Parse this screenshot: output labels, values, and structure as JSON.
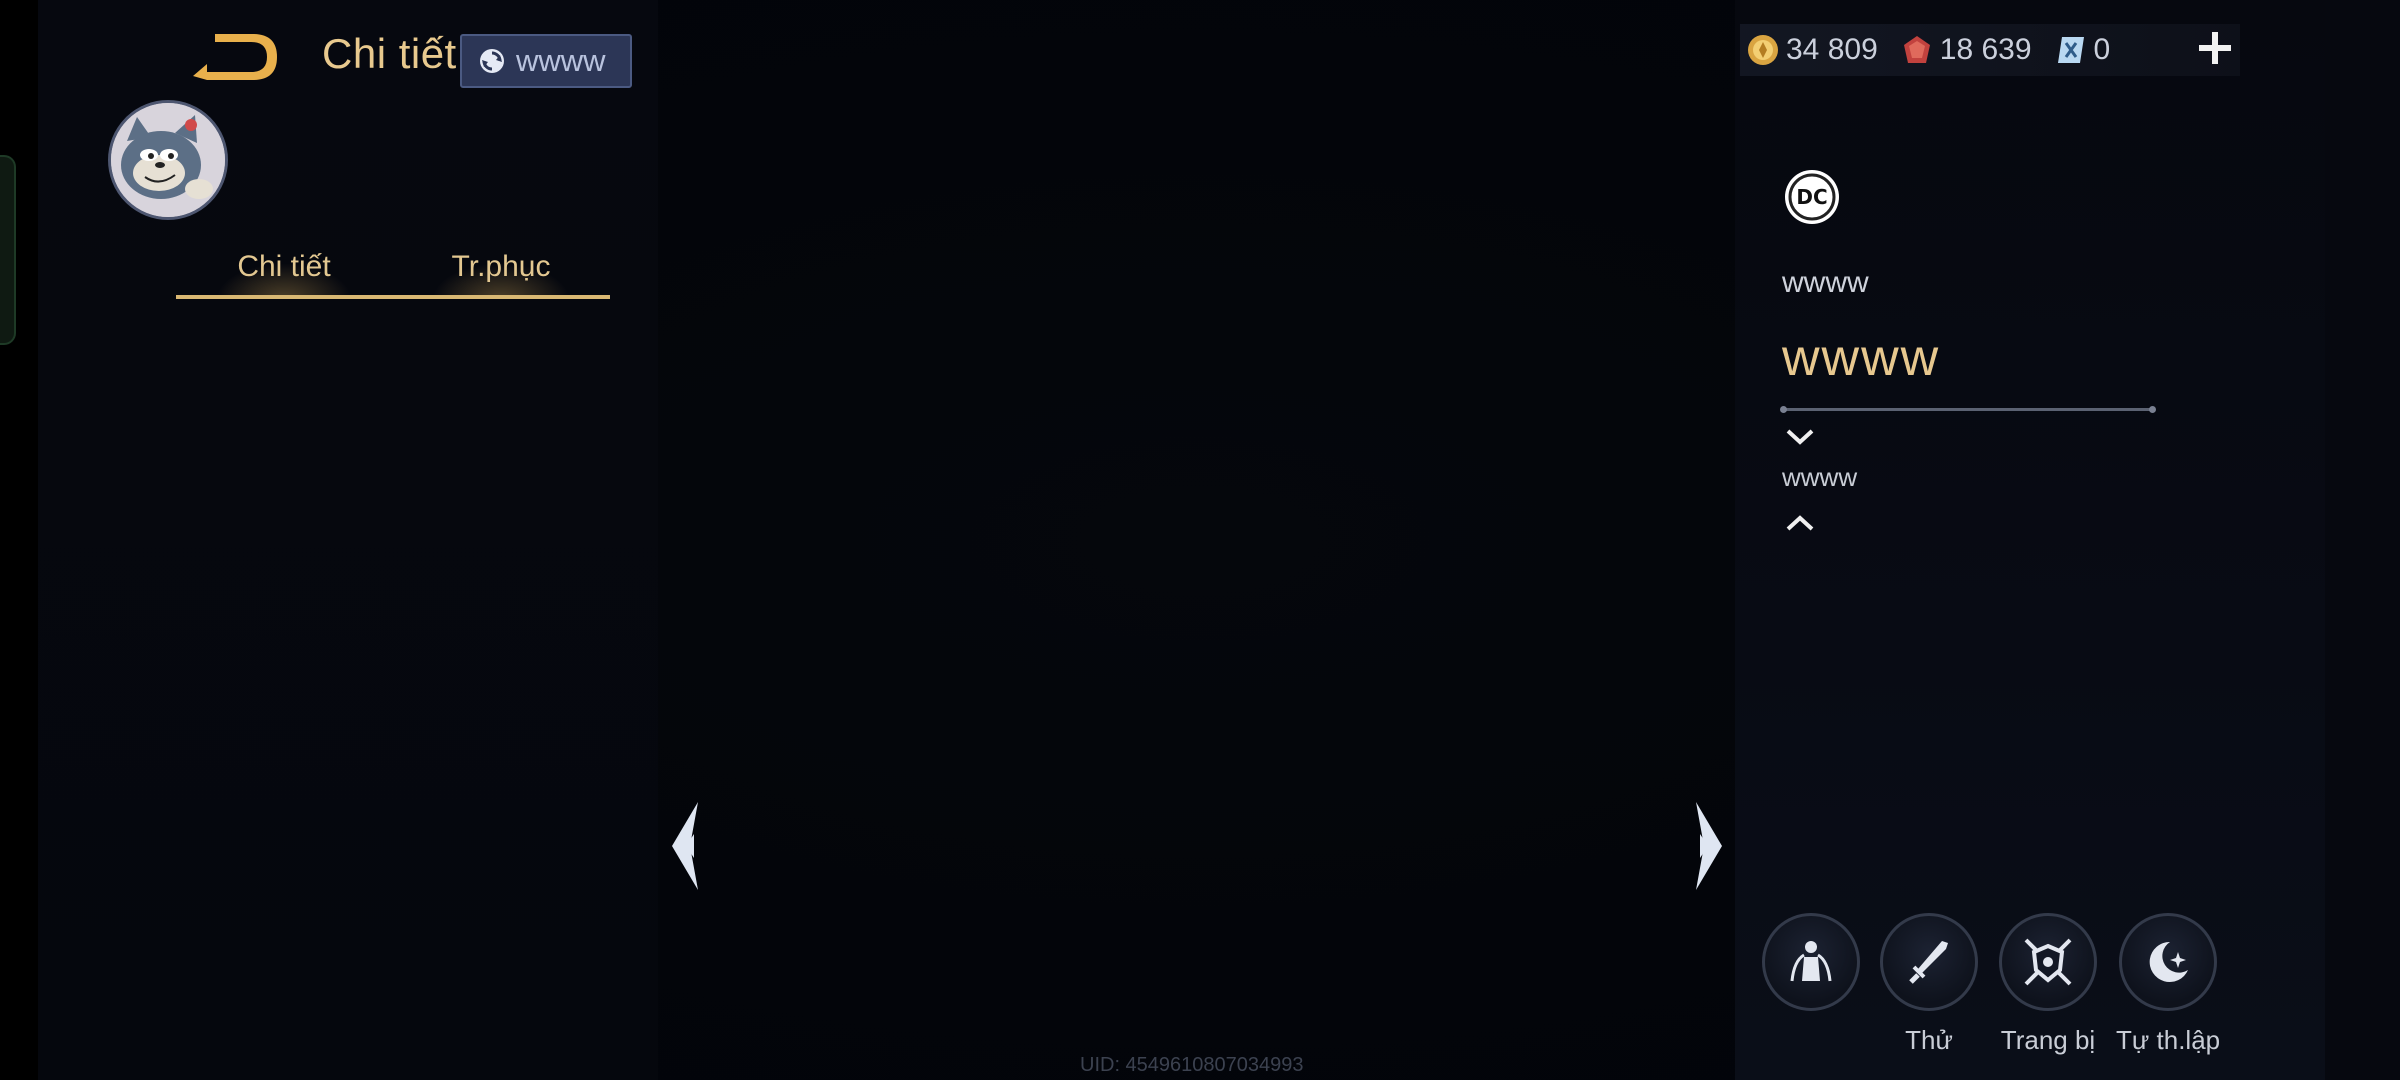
{
  "header": {
    "title": "Chi tiết",
    "badge_text": "wwww"
  },
  "tabs": [
    {
      "label": "Chi tiết"
    },
    {
      "label": "Tr.phục"
    }
  ],
  "currencies": [
    {
      "name": "gold",
      "icon": "gold-coin-icon",
      "value": "34 809"
    },
    {
      "name": "red-gem",
      "icon": "red-gem-icon",
      "value": "18 639"
    },
    {
      "name": "voucher",
      "icon": "voucher-icon",
      "value": "0"
    }
  ],
  "hero": {
    "brand_logo": "DC",
    "subtitle": "wwww",
    "name": "wwww",
    "role": "wwww"
  },
  "actions": [
    {
      "icon": "hero-statue-icon",
      "label": ""
    },
    {
      "icon": "sword-icon",
      "label": "Thử"
    },
    {
      "icon": "shield-crossed-swords-icon",
      "label": "Trang bị"
    },
    {
      "icon": "crescent-moon-icon",
      "label": "Tự th.lập"
    }
  ],
  "footer": {
    "uid": "UID: 4549610807034993"
  },
  "colors": {
    "gold": "#e7c88f",
    "tab_underline": "#d9b873",
    "badge_bg": "#2c3656"
  }
}
